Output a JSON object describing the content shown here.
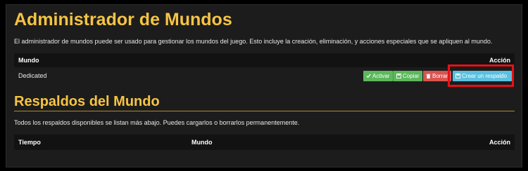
{
  "world_manager": {
    "title": "Administrador de Mundos",
    "description": "El administrador de mundos puede ser usado para gestionar los mundos del juego. Esto incluye la creación, eliminación, y acciones especiales que se apliquen al mundo.",
    "columns": {
      "world": "Mundo",
      "action": "Acción"
    },
    "rows": [
      {
        "name": "Dedicated",
        "buttons": {
          "activate": "Activar",
          "copy": "Copiar",
          "delete": "Borrar",
          "backup": "Crear un respaldo"
        }
      }
    ]
  },
  "backups": {
    "title": "Respaldos del Mundo",
    "description": "Todos los respaldos disponibles se listan más abajo. Puedes cargarlos o borrarlos permanentemente.",
    "columns": {
      "time": "Tiempo",
      "world": "Mundo",
      "action": "Acción"
    }
  },
  "colors": {
    "heading": "#f6c443",
    "success": "#5cb85c",
    "danger": "#d9534f",
    "info": "#5bc0de",
    "highlight": "#e41217"
  }
}
